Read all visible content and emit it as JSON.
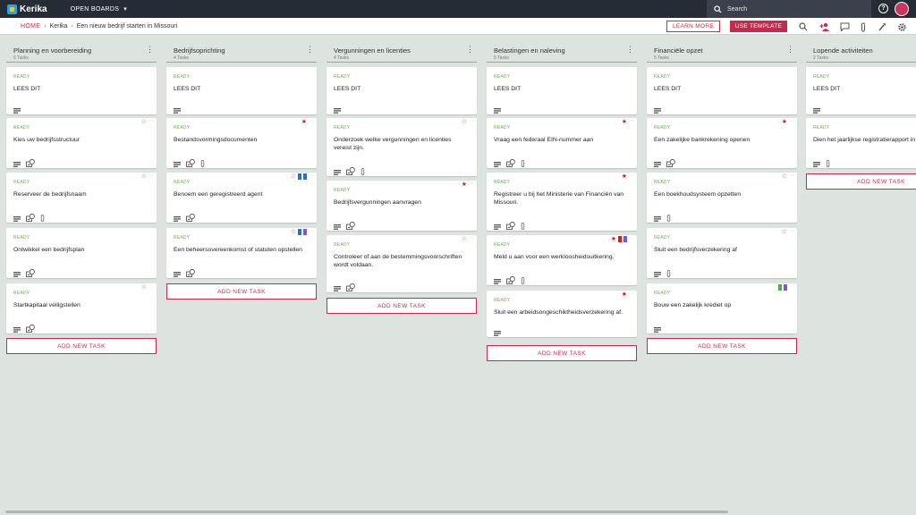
{
  "topbar": {
    "logo": "Kerika",
    "open_boards": "OPEN BOARDS",
    "search_label": "Search",
    "help": "?"
  },
  "breadcrumb": {
    "home": "HOME",
    "account": "Kerika",
    "board": "Een nieuw bedrijf starten in Missouri"
  },
  "buttons": {
    "learn_more": "LEARN MORE",
    "use_template": "USE TEMPLATE"
  },
  "add_task_label": "ADD NEW TASK",
  "columns": [
    {
      "title": "Planning en voorbereiding",
      "count": "5 Tasks",
      "cards": [
        {
          "status": "READY",
          "title": "LEES DIT"
        },
        {
          "status": "READY",
          "title": "Kies uw bedrijfsstructuur"
        },
        {
          "status": "READY",
          "title": "Reserveer de bedrijfsnaam"
        },
        {
          "status": "READY",
          "title": "Ontwikkel een bedrijfsplan"
        },
        {
          "status": "READY",
          "title": "Startkapitaal veiligstellen"
        }
      ]
    },
    {
      "title": "Bedrijfsoprichting",
      "count": "4 Tasks",
      "cards": [
        {
          "status": "READY",
          "title": "LEES DIT"
        },
        {
          "status": "READY",
          "title": "Bestandsvormingsdocumenten"
        },
        {
          "status": "READY",
          "title": "Benoem een geregistreerd agent"
        },
        {
          "status": "READY",
          "title": "Een beheersovereenkomst of statuten opstellen"
        }
      ]
    },
    {
      "title": "Vergunningen en licenties",
      "count": "4 Tasks",
      "cards": [
        {
          "status": "READY",
          "title": "LEES DIT"
        },
        {
          "status": "READY",
          "title": "Onderzoek welke vergunningen en licenties vereist zijn."
        },
        {
          "status": "READY",
          "title": "Bedrijfsvergunningen aanvragen"
        },
        {
          "status": "READY",
          "title": "Controleer of aan de bestemmingsvoorschriften wordt voldaan."
        }
      ]
    },
    {
      "title": "Belastingen en naleving",
      "count": "5 Tasks",
      "cards": [
        {
          "status": "READY",
          "title": "LEES DIT"
        },
        {
          "status": "READY",
          "title": "Vraag een federaal EIN-nummer aan"
        },
        {
          "status": "READY",
          "title": "Registreer u bij het Ministerie van Financiën van Missouri."
        },
        {
          "status": "READY",
          "title": "Meld u aan voor een werkloosheidsuitkering."
        },
        {
          "status": "READY",
          "title": "Sluit een arbeidsongeschiktheidsverzekering af."
        }
      ]
    },
    {
      "title": "Financiële opzet",
      "count": "5 Tasks",
      "cards": [
        {
          "status": "READY",
          "title": "LEES DIT"
        },
        {
          "status": "READY",
          "title": "Een zakelijke bankrekening openen"
        },
        {
          "status": "READY",
          "title": "Een boekhoudsysteem opzetten"
        },
        {
          "status": "READY",
          "title": "Sluit een bedrijfsverzekering af"
        },
        {
          "status": "READY",
          "title": "Bouw een zakelijk krediet op"
        }
      ]
    },
    {
      "title": "Lopende activiteiten",
      "count": "2 Tasks",
      "cards": [
        {
          "status": "READY",
          "title": "LEES DIT"
        },
        {
          "status": "READY",
          "title": "Dien het jaarlijkse registratierapport in"
        }
      ]
    }
  ],
  "colors": {
    "accent": "#c72a4e",
    "topbar": "#262c36",
    "background": "#dde3df",
    "ready_green": "#6ab04c",
    "star_red": "#d21f1f",
    "tag_blue": "#2a6fc9",
    "tag_purple": "#7b5cc4",
    "tag_green": "#5aa84a"
  },
  "icons": [
    "kerika-logo-icon",
    "chevron-down-icon",
    "search-icon",
    "help-icon",
    "avatar",
    "find-icon",
    "add-person-icon",
    "chat-icon",
    "attachment-icon",
    "tools-icon",
    "settings-icon",
    "more-icon",
    "star-icon",
    "tag-icon",
    "chat-icon",
    "checklist-icon",
    "attachment-icon"
  ]
}
